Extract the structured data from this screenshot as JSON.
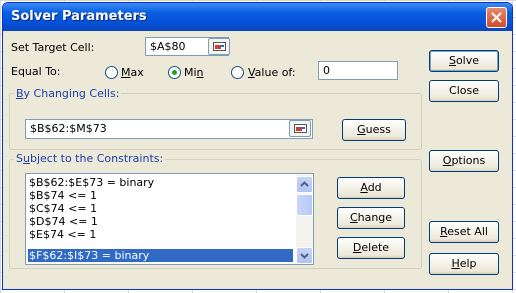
{
  "dialog": {
    "title": "Solver Parameters"
  },
  "target": {
    "label": "Set Target Cell:",
    "value": "$A$80"
  },
  "equal_to": {
    "label": "Equal To:",
    "options": [
      {
        "label": "Max",
        "selected": false
      },
      {
        "label": "Min",
        "selected": true
      },
      {
        "label": "Value of:",
        "selected": false
      }
    ],
    "value_of": "0"
  },
  "changing": {
    "label": "By Changing Cells:",
    "value": "$B$62:$M$73",
    "guess_label": "Guess"
  },
  "constraints": {
    "label": "Subject to the Constraints:",
    "items": [
      "$B$62:$E$73 = binary",
      "$B$74 <= 1",
      "$C$74 <= 1",
      "$D$74 <= 1",
      "$E$74 <= 1",
      "$F$62:$I$73 = binary"
    ],
    "selected_index": 5,
    "add_label": "Add",
    "change_label": "Change",
    "delete_label": "Delete"
  },
  "side_buttons": {
    "solve": "Solve",
    "close": "Close",
    "options": "Options",
    "reset": "Reset All",
    "help": "Help"
  },
  "icons": [
    "close-icon",
    "range-select-icon",
    "scroll-up-icon",
    "scroll-down-icon"
  ]
}
